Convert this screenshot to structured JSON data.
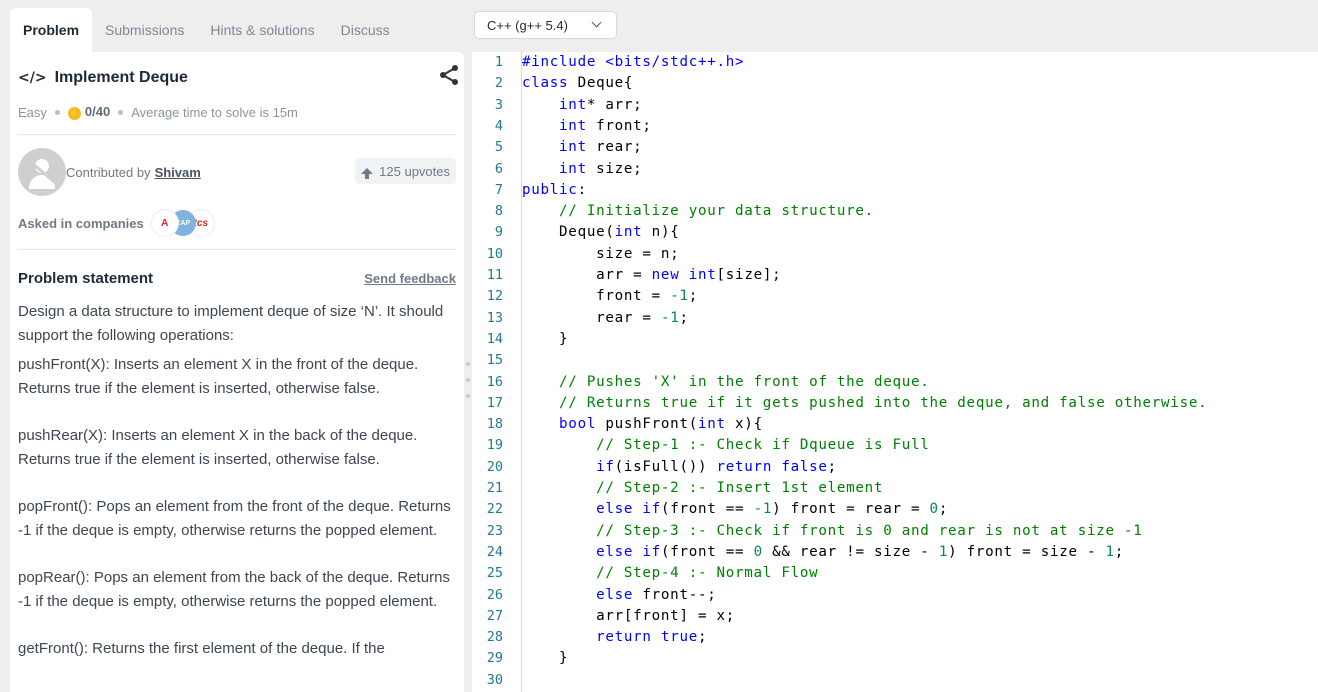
{
  "tabs": [
    {
      "label": "Problem",
      "active": true
    },
    {
      "label": "Submissions",
      "active": false
    },
    {
      "label": "Hints & solutions",
      "active": false
    },
    {
      "label": "Discuss",
      "active": false
    }
  ],
  "problem": {
    "title": "Implement Deque",
    "difficulty": "Easy",
    "score": "0/40",
    "avg_time": "Average time to solve is 15m",
    "contributed_prefix": "Contributed by",
    "contributor": "Shivam",
    "upvotes": "125 upvotes",
    "asked_label": "Asked in companies",
    "company_logos": [
      "adobe-logo",
      "capgemini-logo",
      "tcs-logo"
    ],
    "statement_heading": "Problem statement",
    "send_feedback": "Send feedback",
    "statement": [
      "Design a data structure to implement deque of size ‘N’. It should support the following operations:",
      "pushFront(X): Inserts an element X in the front of the deque. Returns true if the element is inserted, otherwise false.",
      "pushRear(X): Inserts an element X in the back of the deque. Returns true if the element is inserted, otherwise false.",
      "popFront(): Pops an element from the front of the deque. Returns -1 if the deque is empty, otherwise returns the popped element.",
      "popRear(): Pops an element from the back of the deque. Returns -1 if the deque is empty, otherwise returns the popped element.",
      "getFront(): Returns the first element of the deque. If the"
    ]
  },
  "editor": {
    "language": "C++ (g++ 5.4)",
    "line_numbers": [
      "1",
      "2",
      "3",
      "4",
      "5",
      "6",
      "7",
      "8",
      "9",
      "10",
      "11",
      "12",
      "13",
      "14",
      "15",
      "16",
      "17",
      "18",
      "19",
      "20",
      "21",
      "22",
      "23",
      "24",
      "25",
      "26",
      "27",
      "28",
      "29",
      "30"
    ],
    "lines": [
      "#include <bits/stdc++.h>",
      "class Deque{",
      "    int* arr;",
      "    int front;",
      "    int rear;",
      "    int size;",
      "public:",
      "    // Initialize your data structure.",
      "    Deque(int n){",
      "        size = n;",
      "        arr = new int[size];",
      "        front = -1;",
      "        rear = -1;",
      "    }",
      "",
      "    // Pushes 'X' in the front of the deque.",
      "    // Returns true if it gets pushed into the deque, and false otherwise.",
      "    bool pushFront(int x){",
      "        // Step-1 :- Check if Dqueue is Full",
      "        if(isFull()) return false;",
      "        // Step-2 :- Insert 1st element",
      "        else if(front == -1) front = rear = 0;",
      "        // Step-3 :- Check if front is 0 and rear is not at size -1",
      "        else if(front == 0 && rear != size - 1) front = size - 1;",
      "        // Step-4 :- Normal Flow",
      "        else front--;",
      "        arr[front] = x;",
      "        return true;",
      "    }",
      ""
    ]
  },
  "colors": {
    "keyword": "#0000ff",
    "comment": "#008000",
    "number": "#098658",
    "line_number": "#237893"
  }
}
